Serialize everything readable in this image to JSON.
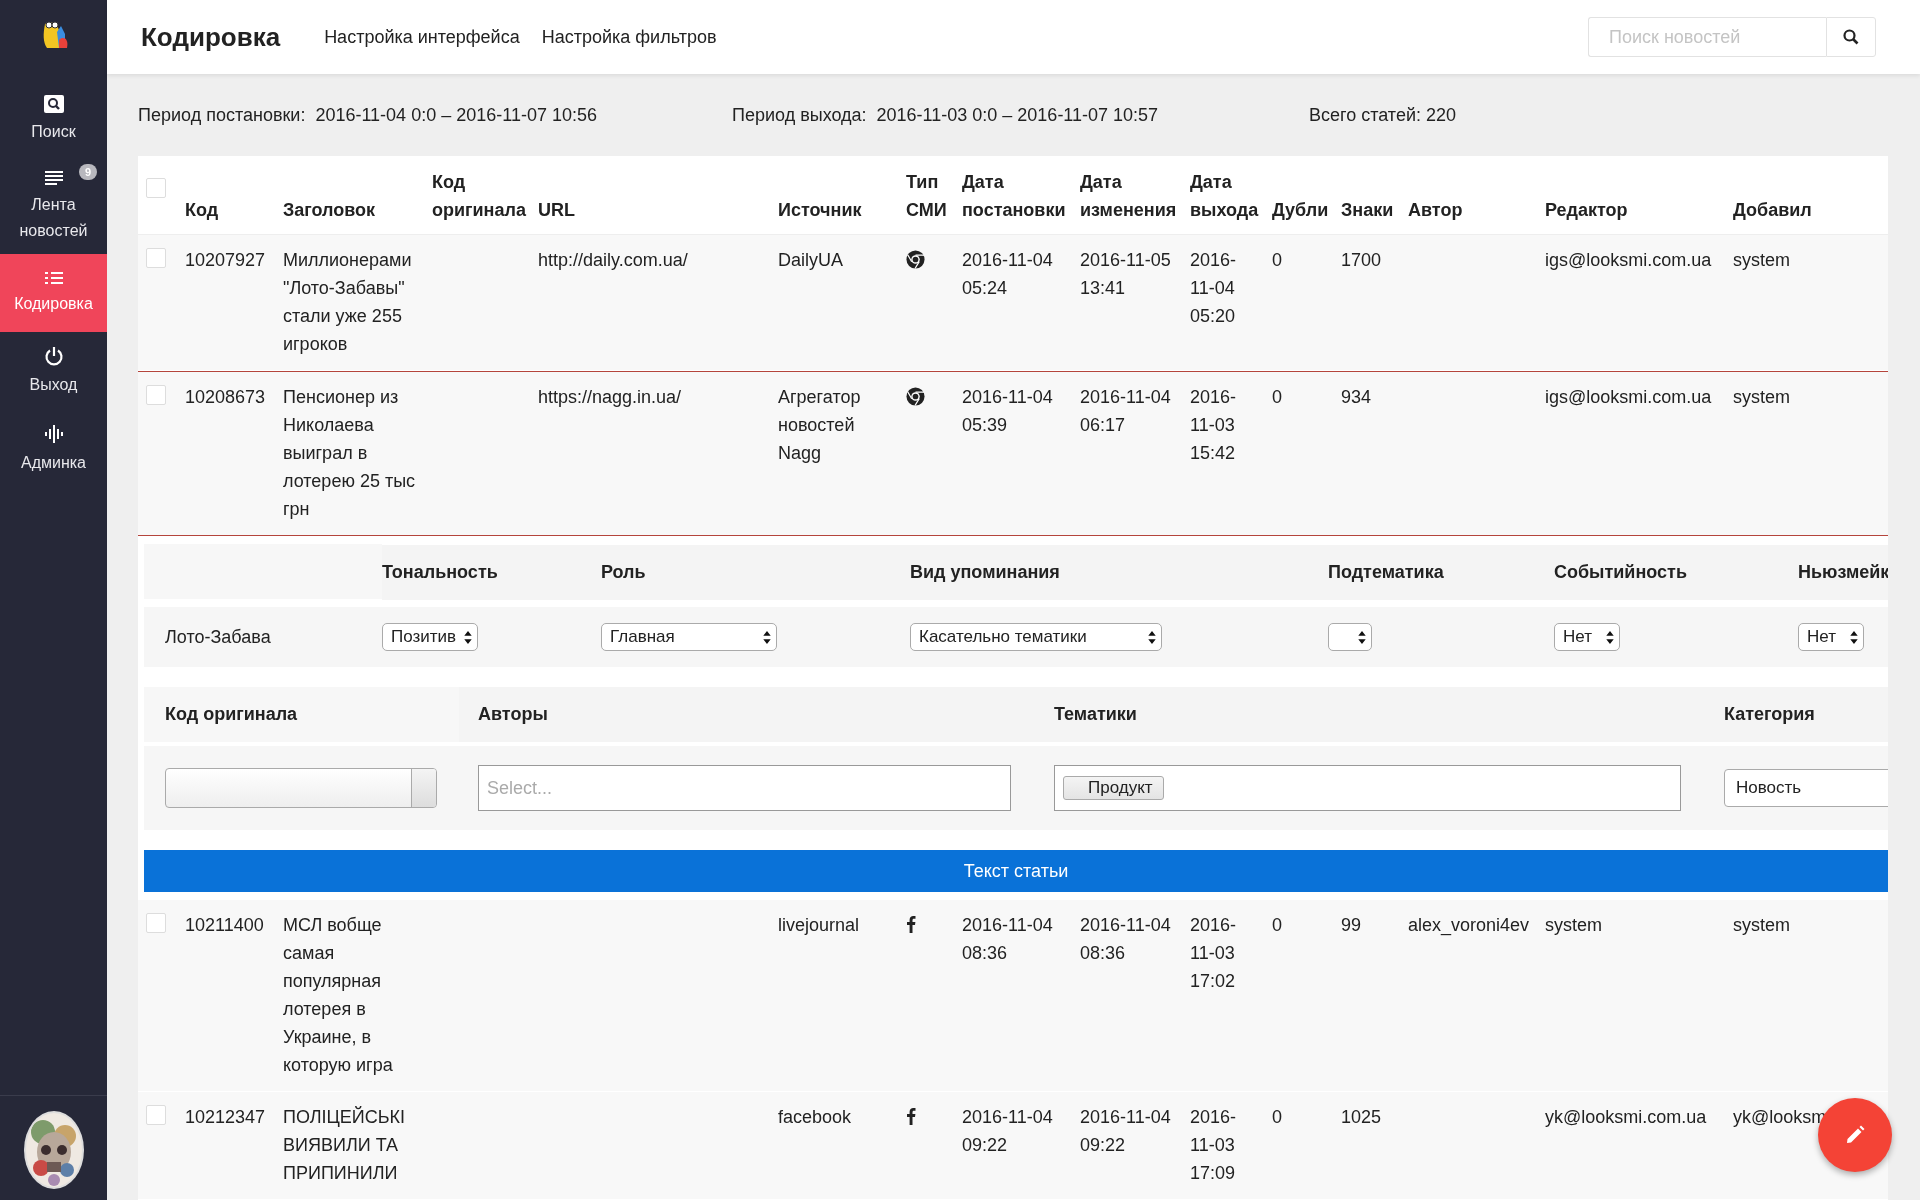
{
  "sidebar": {
    "items": [
      {
        "label": "Поиск",
        "kind": "search",
        "selected": false
      },
      {
        "label": "Лента новостей",
        "kind": "lines",
        "badge": "9",
        "selected": false
      },
      {
        "label": "Кодировка",
        "kind": "bullets",
        "selected": true
      },
      {
        "label": "Выход",
        "kind": "power",
        "selected": false
      },
      {
        "label": "Админка",
        "kind": "bars",
        "selected": false
      }
    ]
  },
  "header": {
    "title": "Кодировка",
    "links": [
      "Настройка интерфейса",
      "Настройка фильтров"
    ],
    "search": {
      "placeholder": "Поиск новостей"
    }
  },
  "summary": [
    "Период постановки:  2016-11-04 0:0 – 2016-11-07 10:56",
    "Период выхода:  2016-11-03 0:0 – 2016-11-07 10:57",
    "Всего статей: 220"
  ],
  "table": {
    "select_all": {
      "checked": false
    },
    "columns": [
      "Код",
      "Заголовок",
      "Код оригинала",
      "URL",
      "Источник",
      "Тип СМИ",
      "Дата постановки",
      "Дата изменения",
      "Дата выхода",
      "Дубли",
      "Знаки",
      "Автор",
      "Редактор",
      "Добавил"
    ],
    "rows": [
      {
        "checked": false,
        "expanded": false,
        "code": "10207927",
        "title": "Миллионерами \"Лото-Забавы\" стали уже 255 игроков",
        "url": "http://daily.com.ua/",
        "source": "DailyUA",
        "kind": "web",
        "posted": "2016-11-04 05:24",
        "changed": "2016-11-05 13:41",
        "published": "2016-11-04 05:20",
        "duplicates": "0",
        "chars": "1700",
        "editor": "igs@looksmi.com.ua",
        "added_by": "system"
      },
      {
        "checked": false,
        "expanded": true,
        "code": "10208673",
        "title": "Пенсионер из Николаева выиграл в лотерею 25 тыс грн",
        "url": "https://nagg.in.ua/",
        "source": "Агрегатор новостей Nagg",
        "kind": "web",
        "posted": "2016-11-04 05:39",
        "changed": "2016-11-04 06:17",
        "published": "2016-11-03 15:42",
        "duplicates": "0",
        "chars": "934",
        "editor": "igs@looksmi.com.ua",
        "added_by": "system"
      },
      {
        "checked": false,
        "expanded": false,
        "code": "10211400",
        "title": "МСЛ вобще самая популярная лотерея в Украине, в которую игра",
        "source": "livejournal",
        "kind": "facebook",
        "posted": "2016-11-04 08:36",
        "changed": "2016-11-04 08:36",
        "published": "2016-11-03 17:02",
        "duplicates": "0",
        "chars": "99",
        "author": "alex_voroni4ev",
        "editor": "system",
        "added_by": "system"
      },
      {
        "checked": false,
        "expanded": false,
        "code": "10212347",
        "title": "ПОЛІЦЕЙСЬКІ ВИЯВИЛИ ТА ПРИПИНИЛИ",
        "source": "facebook",
        "kind": "facebook",
        "posted": "2016-11-04 09:22",
        "changed": "2016-11-04 09:22",
        "published": "2016-11-03 17:09",
        "duplicates": "0",
        "chars": "1025",
        "editor": "yk@looksmi.com.ua",
        "added_by": "yk@looksm"
      }
    ]
  },
  "coding": {
    "columns": [
      "Тональность",
      "Роль",
      "Вид упоминания",
      "Подтематика",
      "Событийность",
      "Ньюзмейк"
    ],
    "mentions": [
      {
        "name": "Лото-Забава",
        "selects": [
          {
            "kind": "dropdown",
            "value": "Позитив"
          },
          {
            "kind": "dropdown",
            "value": "Главная"
          },
          {
            "kind": "dropdown",
            "value": "Касательно тематики"
          },
          {
            "kind": "dropdown"
          },
          {
            "kind": "dropdown",
            "value": "Нет"
          },
          {
            "kind": "dropdown",
            "value": "Нет"
          }
        ]
      }
    ],
    "fields": [
      {
        "kind": "combo",
        "label": "Код оригинала"
      },
      {
        "kind": "multiselect",
        "label": "Авторы",
        "placeholder": "Select..."
      },
      {
        "kind": "tags",
        "label": "Тематики",
        "tags": [
          "Продукт"
        ]
      },
      {
        "kind": "select",
        "label": "Категория",
        "value": "Новость"
      }
    ],
    "text_button": "Текст статьи"
  }
}
